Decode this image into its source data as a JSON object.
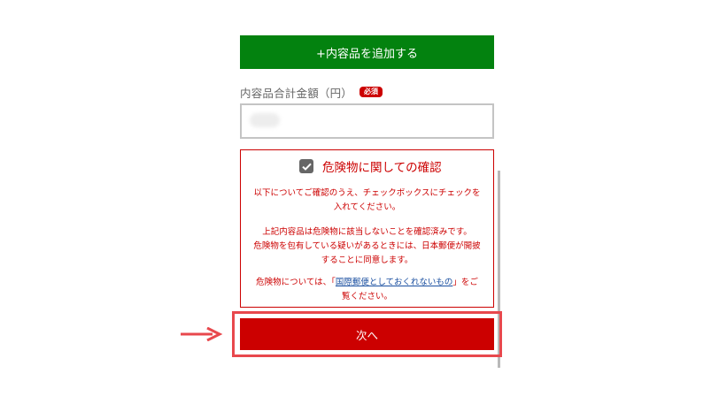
{
  "colors": {
    "green": "#03820f",
    "red": "#cc0000",
    "highlight": "#e8484d",
    "link": "#1a4fa0",
    "checkbox": "#666666"
  },
  "add_item": {
    "label": "+内容品を追加する"
  },
  "total": {
    "label": "内容品合計金額（円）",
    "required_badge": "必須",
    "value": "",
    "value_obscured": true
  },
  "danger": {
    "checked": true,
    "title": "危険物に関しての確認",
    "notice1_lines": [
      "以下についてご確認のうえ、チェックボックスにチェックを",
      "入れてください。"
    ],
    "notice2_lines": [
      "上記内容品は危険物に該当しないことを確認済みです。",
      "危険物を包有している疑いがあるときには、日本郵便が開披",
      "することに同意します。"
    ],
    "notice3_prefix": "危険物については、「",
    "notice3_link": "国際郵便としておくれないもの",
    "notice3_suffix": "」をご",
    "notice3_line2": "覧ください。"
  },
  "next_button": {
    "label": "次へ"
  },
  "pointer": {
    "icon": "right-arrow-icon"
  }
}
